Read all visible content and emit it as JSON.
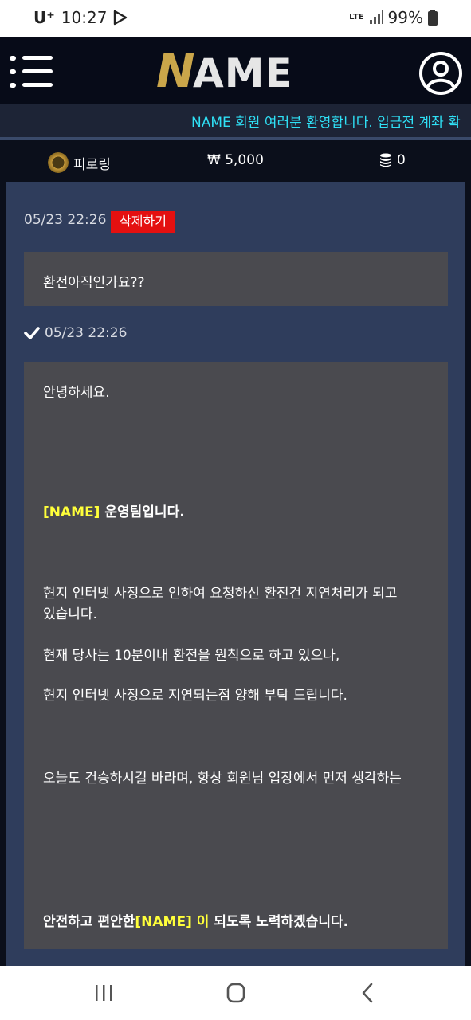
{
  "status_bar": {
    "carrier": "U⁺",
    "time": "10:27",
    "network": "LTE",
    "battery": "99%"
  },
  "header": {
    "logo_first": "N",
    "logo_rest": "AME"
  },
  "marquee": {
    "text": "NAME 회원 여러분 환영합니다. 입금전 계좌 확"
  },
  "info_bar": {
    "rank": "피로링",
    "balance": "₩ 5,000",
    "points": "0"
  },
  "question": {
    "datetime": "05/23 22:26",
    "delete_label": "삭제하기",
    "content": "환전아직인가요??"
  },
  "answer": {
    "datetime": "05/23 22:26",
    "lines": {
      "greeting": "안녕하세요.",
      "team_name": "[NAME]",
      "team_suffix": " 운영팀입니다.",
      "line1": "현지 인터넷 사정으로 인하여 요청하신 환전건 지연처리가 되고",
      "line2": "있습니다.",
      "line3": "현재 당사는 10분이내 환전을 원칙으로 하고 있으나,",
      "line4": "현지 인터넷 사정으로 지연되는점 양해 부탁 드립니다.",
      "line5": "오늘도 건승하시길 바라며, 항상 회원님 입장에서 먼저 생각하는",
      "closing_prefix": "안전하고 편안한",
      "closing_name": "[NAME] 이",
      "closing_suffix": " 되도록 노력하겠습니다."
    }
  },
  "colors": {
    "header_bg": "#070b18",
    "marquee_text": "#2fe0f5",
    "panel_bg": "#2f3d5c",
    "message_bg": "#4a4a4f",
    "delete_bg": "#e41010",
    "highlight": "#ffff3a",
    "logo_gold": "#caa64a"
  }
}
